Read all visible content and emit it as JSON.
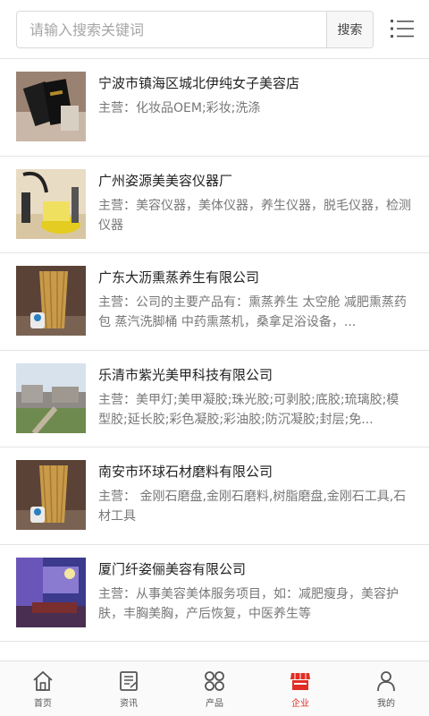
{
  "search": {
    "placeholder": "请输入搜索关键词",
    "button_label": "搜索"
  },
  "listings": [
    {
      "title": "宁波市镇海区城北伊纯女子美容店",
      "desc": "主营：化妆品OEM;彩妆;洗涤"
    },
    {
      "title": "广州姿源美美容仪器厂",
      "desc": "主营：美容仪器，美体仪器，养生仪器，脱毛仪器，检测仪器"
    },
    {
      "title": "广东大沥熏蒸养生有限公司",
      "desc": "主营：公司的主要产品有：熏蒸养生 太空舱 减肥熏蒸药包 蒸汽洗脚桶 中药熏蒸机，桑拿足浴设备，..."
    },
    {
      "title": "乐清市紫光美甲科技有限公司",
      "desc": "主营：美甲灯;美甲凝胶;珠光胶;可剥胶;底胶;琉璃胶;模型胶;延长胶;彩色凝胶;彩油胶;防沉凝胶;封层;免..."
    },
    {
      "title": "南安市环球石材磨料有限公司",
      "desc": "主营： 金刚石磨盘,金刚石磨料,树脂磨盘,金刚石工具,石材工具"
    },
    {
      "title": "厦门纤姿俪美容有限公司",
      "desc": "主营：从事美容美体服务项目，如：减肥瘦身，美容护肤，丰胸美胸，产后恢复，中医养生等"
    }
  ],
  "tabbar": {
    "tabs": [
      {
        "label": "首页"
      },
      {
        "label": "资讯"
      },
      {
        "label": "产品"
      },
      {
        "label": "企业"
      },
      {
        "label": "我的"
      }
    ],
    "active_color": "#e02e24"
  }
}
